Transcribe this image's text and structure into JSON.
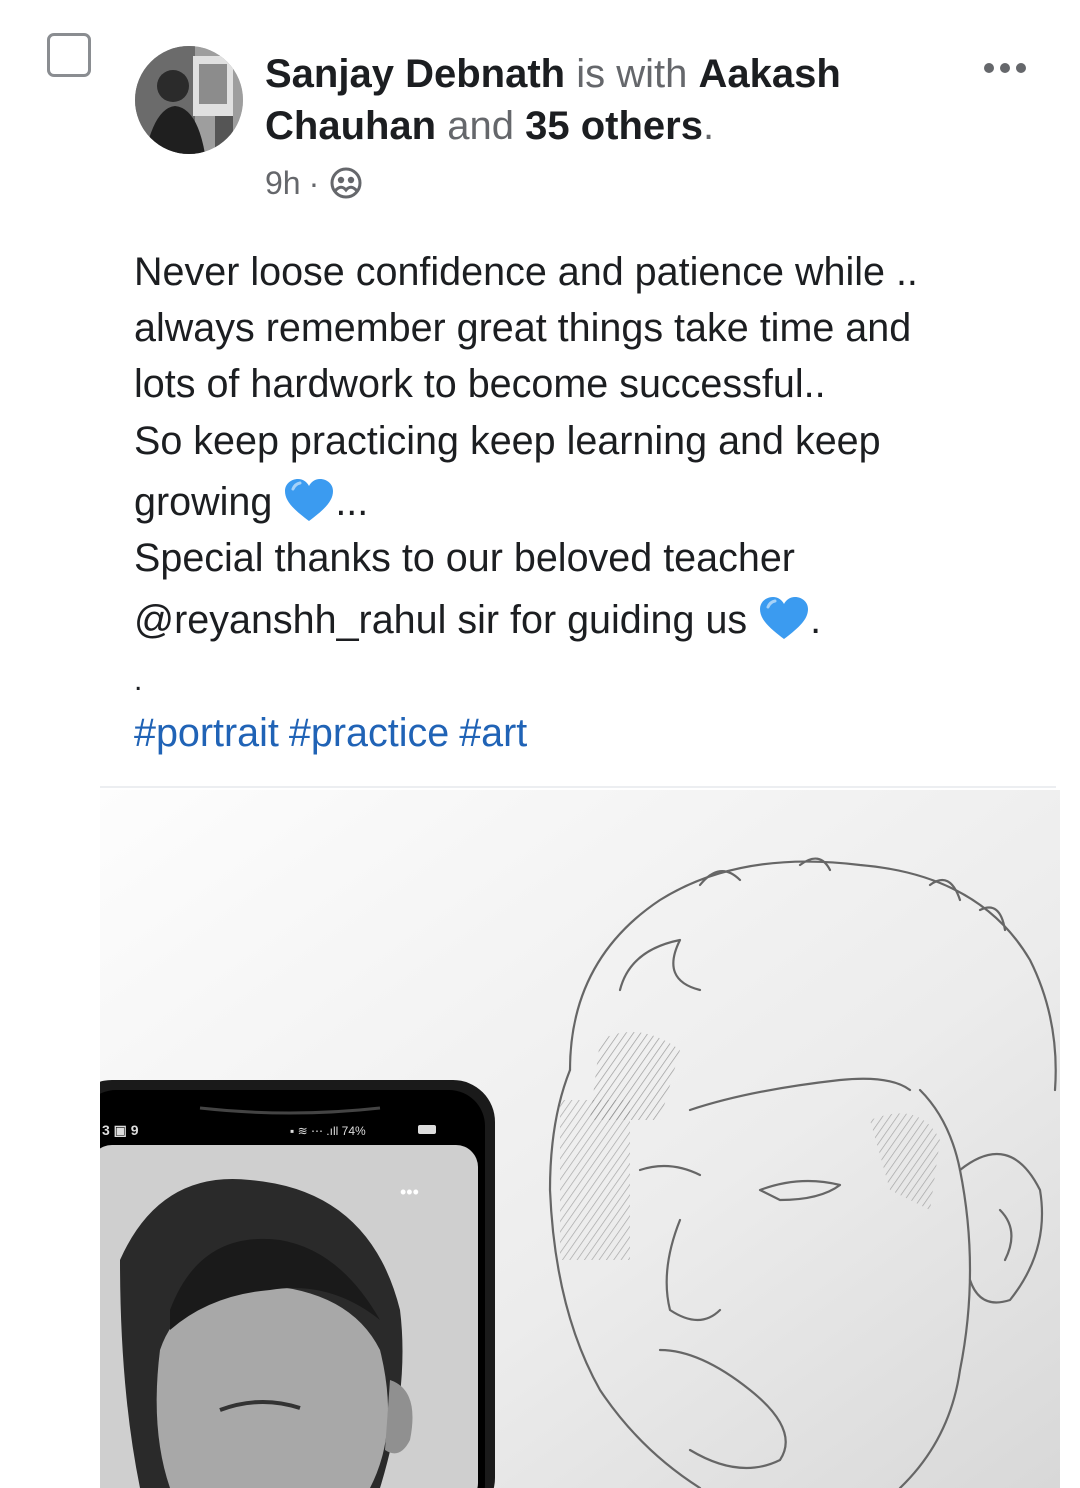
{
  "post": {
    "author": "Sanjay Debnath",
    "is_with": "is with",
    "tagged_person_first": "Aakash",
    "tagged_person_last": "Chauhan",
    "and_text": "and",
    "others": "35 others",
    "period": ".",
    "time": "9h",
    "time_separator": "·",
    "audience_icon": "friends-icon",
    "text_lines": [
      "Never loose confidence and patience while ..",
      "always remember great things take time and",
      "lots of hardwork to become successful..",
      "So keep practicing keep learning and keep",
      "growing",
      "...",
      "Special thanks to our beloved teacher",
      "@reyanshh_rahul sir for guiding us",
      ".",
      "."
    ],
    "hashtags": [
      "#portrait",
      "#practice",
      "#art"
    ]
  },
  "photo": {
    "phone_status_left": "3 9",
    "phone_battery": "74%",
    "phone_menu": "•••"
  },
  "colors": {
    "hashtag": "#2063b6",
    "heart": "#3b9bf0",
    "secondary_text": "#65676b"
  },
  "icons": {
    "more": "more-options-icon",
    "heart": "blue-heart-emoji",
    "checkbox": "checkbox-icon"
  }
}
